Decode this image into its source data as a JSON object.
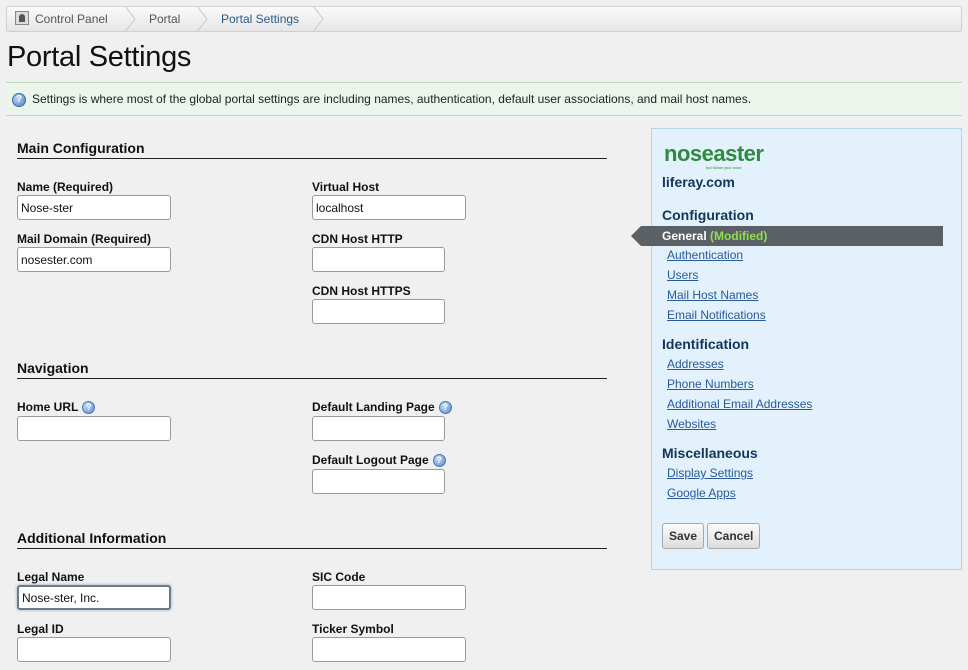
{
  "breadcrumb": {
    "items": [
      "Control Panel",
      "Portal",
      "Portal Settings"
    ]
  },
  "page": {
    "title": "Portal Settings",
    "info": "Settings is where most of the global portal settings are including names, authentication, default user associations, and mail host names."
  },
  "main_configuration": {
    "title": "Main Configuration",
    "name_label": "Name (Required)",
    "name_value": "Nose-ster",
    "mail_domain_label": "Mail Domain (Required)",
    "mail_domain_value": "nosester.com",
    "virtual_host_label": "Virtual Host",
    "virtual_host_value": "localhost",
    "cdn_http_label": "CDN Host HTTP",
    "cdn_http_value": "",
    "cdn_https_label": "CDN Host HTTPS",
    "cdn_https_value": ""
  },
  "navigation": {
    "title": "Navigation",
    "home_url_label": "Home URL",
    "home_url_value": "",
    "landing_label": "Default Landing Page",
    "landing_value": "",
    "logout_label": "Default Logout Page",
    "logout_value": ""
  },
  "additional": {
    "title": "Additional Information",
    "legal_name_label": "Legal Name",
    "legal_name_value": "Nose-ster, Inc.",
    "sic_label": "SIC Code",
    "sic_value": "",
    "legal_id_label": "Legal ID",
    "legal_id_value": "",
    "ticker_label": "Ticker Symbol",
    "ticker_value": ""
  },
  "sidebar": {
    "logo_text": "noseaster",
    "logo_tagline": "but follow your nose",
    "company": "liferay.com",
    "configuration_heading": "Configuration",
    "current_item": "General",
    "current_badge": "(Modified)",
    "configuration_links": [
      "Authentication",
      "Users",
      "Mail Host Names",
      "Email Notifications"
    ],
    "identification_heading": "Identification",
    "identification_links": [
      "Addresses",
      "Phone Numbers",
      "Additional Email Addresses",
      "Websites"
    ],
    "misc_heading": "Miscellaneous",
    "misc_links": [
      "Display Settings",
      "Google Apps"
    ],
    "save_label": "Save",
    "cancel_label": "Cancel"
  },
  "colors": {
    "logo_green": "#2e8b3e",
    "nav_heading": "#12365a",
    "link_blue": "#2a5a9a",
    "modified_green": "#8fe04a"
  }
}
